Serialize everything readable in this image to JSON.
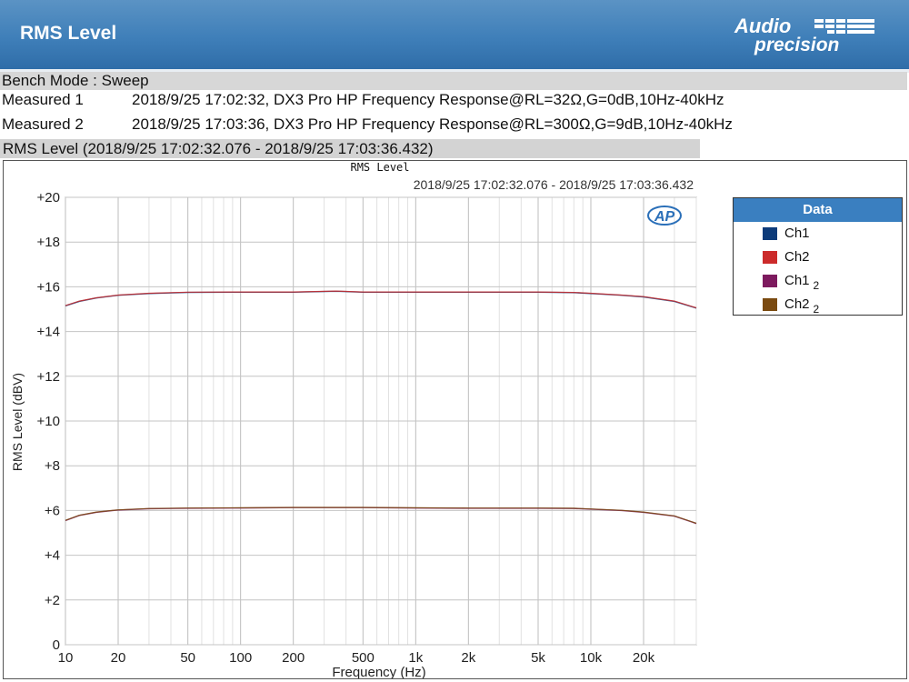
{
  "header": {
    "title": "RMS Level",
    "logo_line1": "Audio",
    "logo_line2": "precision"
  },
  "info": {
    "bench_mode": "Bench Mode : Sweep",
    "measured": [
      {
        "label": "Measured 1",
        "text": "2018/9/25 17:02:32, DX3 Pro HP Frequency Response@RL=32Ω,G=0dB,10Hz-40kHz"
      },
      {
        "label": "Measured 2",
        "text": "2018/9/25 17:03:36, DX3 Pro HP Frequency Response@RL=300Ω,G=9dB,10Hz-40kHz"
      }
    ],
    "section_title": "RMS Level (2018/9/25 17:02:32.076 - 2018/9/25 17:03:36.432)"
  },
  "chart_data": {
    "type": "line",
    "title": "RMS Level",
    "subtitle": "2018/9/25 17:02:32.076 - 2018/9/25 17:03:36.432",
    "xlabel": "Frequency (Hz)",
    "ylabel": "RMS Level (dBV)",
    "x_scale": "log",
    "xlim": [
      10,
      40000
    ],
    "ylim": [
      0,
      20
    ],
    "x_ticks": [
      10,
      20,
      50,
      100,
      200,
      500,
      1000,
      2000,
      5000,
      10000,
      20000
    ],
    "x_tick_labels": [
      "10",
      "20",
      "50",
      "100",
      "200",
      "500",
      "1k",
      "2k",
      "5k",
      "10k",
      "20k"
    ],
    "y_ticks": [
      0,
      2,
      4,
      6,
      8,
      10,
      12,
      14,
      16,
      18,
      20
    ],
    "y_tick_labels": [
      "0",
      "+2",
      "+4",
      "+6",
      "+8",
      "+10",
      "+12",
      "+14",
      "+16",
      "+18",
      "+20"
    ],
    "grid": true,
    "legend_position": "right",
    "legend_title": "Data",
    "series": [
      {
        "name": "Ch1",
        "sub": "",
        "color": "#0d3b7a",
        "x": [
          10,
          12,
          15,
          20,
          30,
          50,
          100,
          200,
          350,
          500,
          1000,
          2000,
          5000,
          8000,
          10000,
          15000,
          20000,
          30000,
          40000
        ],
        "y": [
          15.15,
          15.35,
          15.5,
          15.62,
          15.7,
          15.75,
          15.76,
          15.76,
          15.8,
          15.76,
          15.76,
          15.76,
          15.76,
          15.74,
          15.7,
          15.62,
          15.55,
          15.35,
          15.05
        ]
      },
      {
        "name": "Ch2",
        "sub": "",
        "color": "#cc2b2b",
        "x": [
          10,
          12,
          15,
          20,
          30,
          50,
          100,
          200,
          350,
          500,
          1000,
          2000,
          5000,
          8000,
          10000,
          15000,
          20000,
          30000,
          40000
        ],
        "y": [
          15.16,
          15.36,
          15.51,
          15.63,
          15.71,
          15.76,
          15.77,
          15.77,
          15.81,
          15.77,
          15.77,
          15.77,
          15.77,
          15.75,
          15.71,
          15.63,
          15.56,
          15.36,
          15.06
        ]
      },
      {
        "name": "Ch1",
        "sub": "2",
        "color": "#7d1a5e",
        "x": [
          10,
          12,
          15,
          20,
          30,
          50,
          100,
          200,
          500,
          1000,
          2000,
          5000,
          8000,
          10000,
          15000,
          20000,
          30000,
          40000
        ],
        "y": [
          5.55,
          5.78,
          5.92,
          6.02,
          6.08,
          6.1,
          6.11,
          6.13,
          6.13,
          6.11,
          6.1,
          6.1,
          6.09,
          6.06,
          6.0,
          5.92,
          5.75,
          5.42
        ]
      },
      {
        "name": "Ch2",
        "sub": "2",
        "color": "#7a4a10",
        "x": [
          10,
          12,
          15,
          20,
          30,
          50,
          100,
          200,
          500,
          1000,
          2000,
          5000,
          8000,
          10000,
          15000,
          20000,
          30000,
          40000
        ],
        "y": [
          5.56,
          5.79,
          5.93,
          6.03,
          6.09,
          6.11,
          6.12,
          6.14,
          6.14,
          6.12,
          6.11,
          6.11,
          6.1,
          6.07,
          6.01,
          5.93,
          5.76,
          5.43
        ]
      }
    ]
  }
}
